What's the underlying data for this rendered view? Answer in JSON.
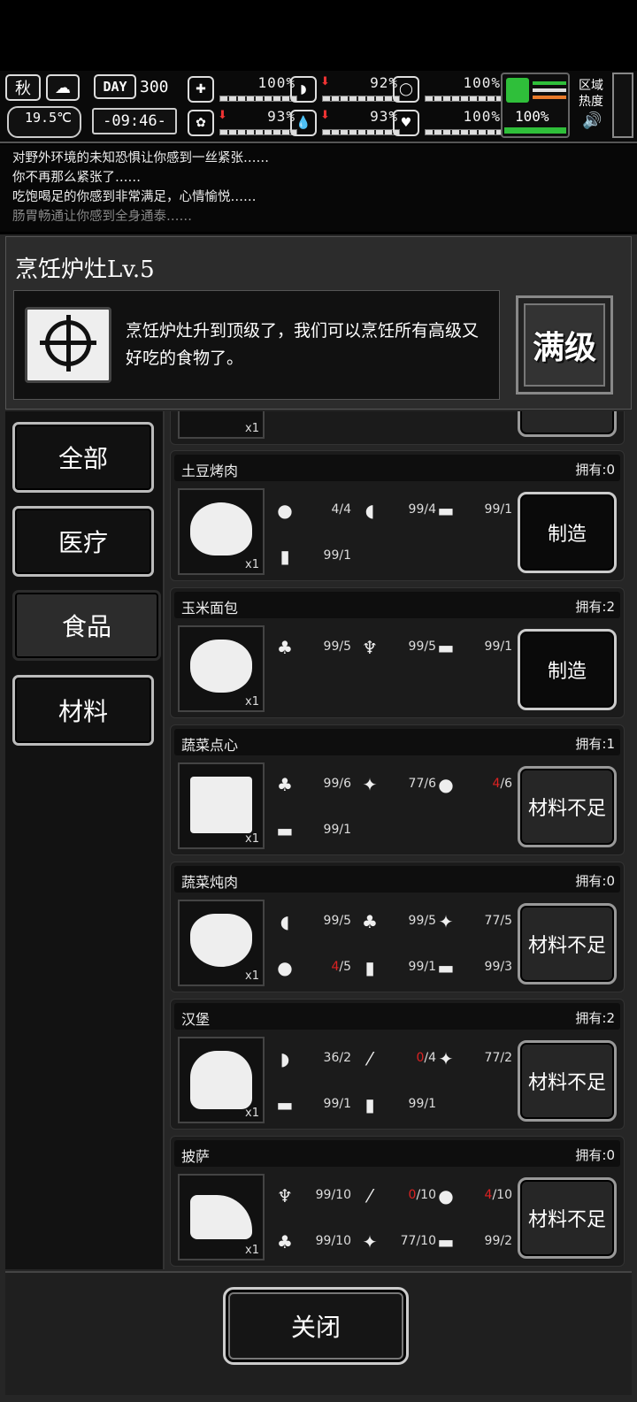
{
  "status": {
    "season": "秋",
    "temperature": "19.5℃",
    "day_label": "DAY",
    "day": "300",
    "time": "-09:46-",
    "stats": [
      {
        "icon": "medkit-icon",
        "value": "100%",
        "level": 1.0,
        "down": false
      },
      {
        "icon": "stomach-icon",
        "value": "92%",
        "level": 0.92,
        "down": true
      },
      {
        "icon": "bladder-icon",
        "value": "100%",
        "level": 1.0,
        "down": false
      },
      {
        "icon": "brain-icon",
        "value": "93%",
        "level": 0.93,
        "down": true
      },
      {
        "icon": "water-drop-icon",
        "value": "93%",
        "level": 0.93,
        "down": true
      },
      {
        "icon": "heart-icon",
        "value": "100%",
        "level": 1.0,
        "down": false
      }
    ],
    "stamina": "100%",
    "region_heat": "区域\n热度"
  },
  "log": [
    "对野外环境的未知恐惧让你感到一丝紧张……",
    "你不再那么紧张了……",
    "吃饱喝足的你感到非常满足，心情愉悦……",
    "肠胃畅通让你感到全身通泰……"
  ],
  "header": {
    "title": "烹饪炉灶Lv.5",
    "description": "烹饪炉灶升到顶级了，我们可以烹饪所有高级又好吃的食物了。",
    "max_label": "满级"
  },
  "categories": [
    "全部",
    "医疗",
    "食品",
    "材料"
  ],
  "active_category": "食品",
  "top_partial_qty": "x1",
  "recipes": [
    {
      "name": "土豆烤肉",
      "owned": "拥有:0",
      "qty": "x1",
      "button": "制造",
      "can_make": true,
      "ingredients": [
        {
          "icon": "potato-icon",
          "glyph": "●",
          "have": "",
          "need": "4/4",
          "short": false
        },
        {
          "icon": "meat-icon",
          "glyph": "◖",
          "have": "",
          "need": "99/4",
          "short": false
        },
        {
          "icon": "firewood-icon",
          "glyph": "▬",
          "have": "",
          "need": "99/1",
          "short": false
        },
        {
          "icon": "oil-bottle-icon",
          "glyph": "▮",
          "have": "",
          "need": "99/1",
          "short": false
        }
      ]
    },
    {
      "name": "玉米面包",
      "owned": "拥有:2",
      "qty": "x1",
      "button": "制造",
      "can_make": true,
      "ingredients": [
        {
          "icon": "corn-icon",
          "glyph": "♣",
          "have": "",
          "need": "99/5",
          "short": false
        },
        {
          "icon": "wheat-icon",
          "glyph": "♆",
          "have": "",
          "need": "99/5",
          "short": false
        },
        {
          "icon": "firewood-icon",
          "glyph": "▬",
          "have": "",
          "need": "99/1",
          "short": false
        }
      ]
    },
    {
      "name": "蔬菜点心",
      "owned": "拥有:1",
      "qty": "x1",
      "button": "材料不足",
      "can_make": false,
      "ingredients": [
        {
          "icon": "corn-icon",
          "glyph": "♣",
          "have": "",
          "need": "99/6",
          "short": false
        },
        {
          "icon": "carrot-icon",
          "glyph": "✦",
          "have": "",
          "need": "77/6",
          "short": false
        },
        {
          "icon": "potato-icon",
          "glyph": "●",
          "have": "4",
          "need": "/6",
          "short": true
        },
        {
          "icon": "firewood-icon",
          "glyph": "▬",
          "have": "",
          "need": "99/1",
          "short": false
        }
      ]
    },
    {
      "name": "蔬菜炖肉",
      "owned": "拥有:0",
      "qty": "x1",
      "button": "材料不足",
      "can_make": false,
      "ingredients": [
        {
          "icon": "meat-icon",
          "glyph": "◖",
          "have": "",
          "need": "99/5",
          "short": false
        },
        {
          "icon": "corn-icon",
          "glyph": "♣",
          "have": "",
          "need": "99/5",
          "short": false
        },
        {
          "icon": "carrot-icon",
          "glyph": "✦",
          "have": "",
          "need": "77/5",
          "short": false
        },
        {
          "icon": "potato-icon",
          "glyph": "●",
          "have": "4",
          "need": "/5",
          "short": true
        },
        {
          "icon": "oil-bottle-icon",
          "glyph": "▮",
          "have": "",
          "need": "99/1",
          "short": false
        },
        {
          "icon": "firewood-icon",
          "glyph": "▬",
          "have": "",
          "need": "99/3",
          "short": false
        }
      ]
    },
    {
      "name": "汉堡",
      "owned": "拥有:2",
      "qty": "x1",
      "button": "材料不足",
      "can_make": false,
      "ingredients": [
        {
          "icon": "bread-icon",
          "glyph": "◗",
          "have": "",
          "need": "36/2",
          "short": false
        },
        {
          "icon": "herb-icon",
          "glyph": "⁄",
          "have": "0",
          "need": "/4",
          "short": true
        },
        {
          "icon": "carrot-icon",
          "glyph": "✦",
          "have": "",
          "need": "77/2",
          "short": false
        },
        {
          "icon": "firewood-icon",
          "glyph": "▬",
          "have": "",
          "need": "99/1",
          "short": false
        },
        {
          "icon": "oil-bottle-icon",
          "glyph": "▮",
          "have": "",
          "need": "99/1",
          "short": false
        }
      ]
    },
    {
      "name": "披萨",
      "owned": "拥有:0",
      "qty": "x1",
      "button": "材料不足",
      "can_make": false,
      "ingredients": [
        {
          "icon": "wheat-icon",
          "glyph": "♆",
          "have": "",
          "need": "99/10",
          "short": false
        },
        {
          "icon": "herb-icon",
          "glyph": "⁄",
          "have": "0",
          "need": "/10",
          "short": true
        },
        {
          "icon": "potato-icon",
          "glyph": "●",
          "have": "4",
          "need": "/10",
          "short": true
        },
        {
          "icon": "corn-icon",
          "glyph": "♣",
          "have": "",
          "need": "99/10",
          "short": false
        },
        {
          "icon": "carrot-icon",
          "glyph": "✦",
          "have": "",
          "need": "77/10",
          "short": false
        },
        {
          "icon": "firewood-icon",
          "glyph": "▬",
          "have": "",
          "need": "99/2",
          "short": false
        }
      ]
    }
  ],
  "close_label": "关闭"
}
